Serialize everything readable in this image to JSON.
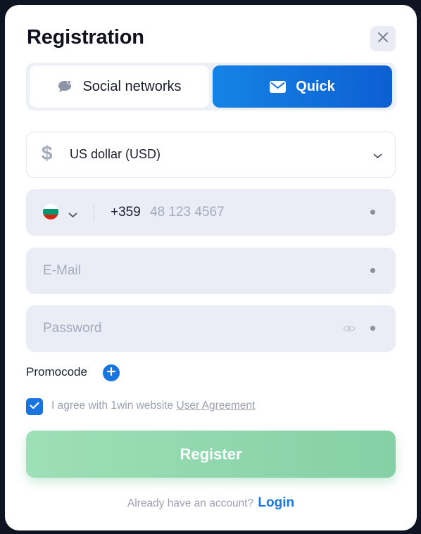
{
  "title": "Registration",
  "tabs": {
    "social_label": "Social networks",
    "quick_label": "Quick"
  },
  "currency": {
    "symbol": "$",
    "selected": "US dollar (USD)"
  },
  "phone": {
    "country_code": "+359",
    "placeholder": "48 123 4567",
    "flag_colors": [
      "#ffffff",
      "#00966e",
      "#d62612"
    ]
  },
  "email": {
    "placeholder": "E-Mail"
  },
  "password": {
    "placeholder": "Password"
  },
  "promocode": {
    "label": "Promocode"
  },
  "agreement": {
    "text": "I agree with 1win website ",
    "link": "User Agreement",
    "checked": true
  },
  "register": {
    "label": "Register"
  },
  "footer": {
    "question": "Already have an account?",
    "login_label": "Login"
  },
  "colors": {
    "accent": "#1a74e0",
    "register": "#8fd7ac",
    "field_bg": "#eaedf5"
  },
  "icons": [
    "close-icon",
    "chat-icon",
    "mail-icon",
    "dollar-icon",
    "chevron-down-icon",
    "flag-bg-icon",
    "eye-icon",
    "plus-icon",
    "check-icon"
  ]
}
